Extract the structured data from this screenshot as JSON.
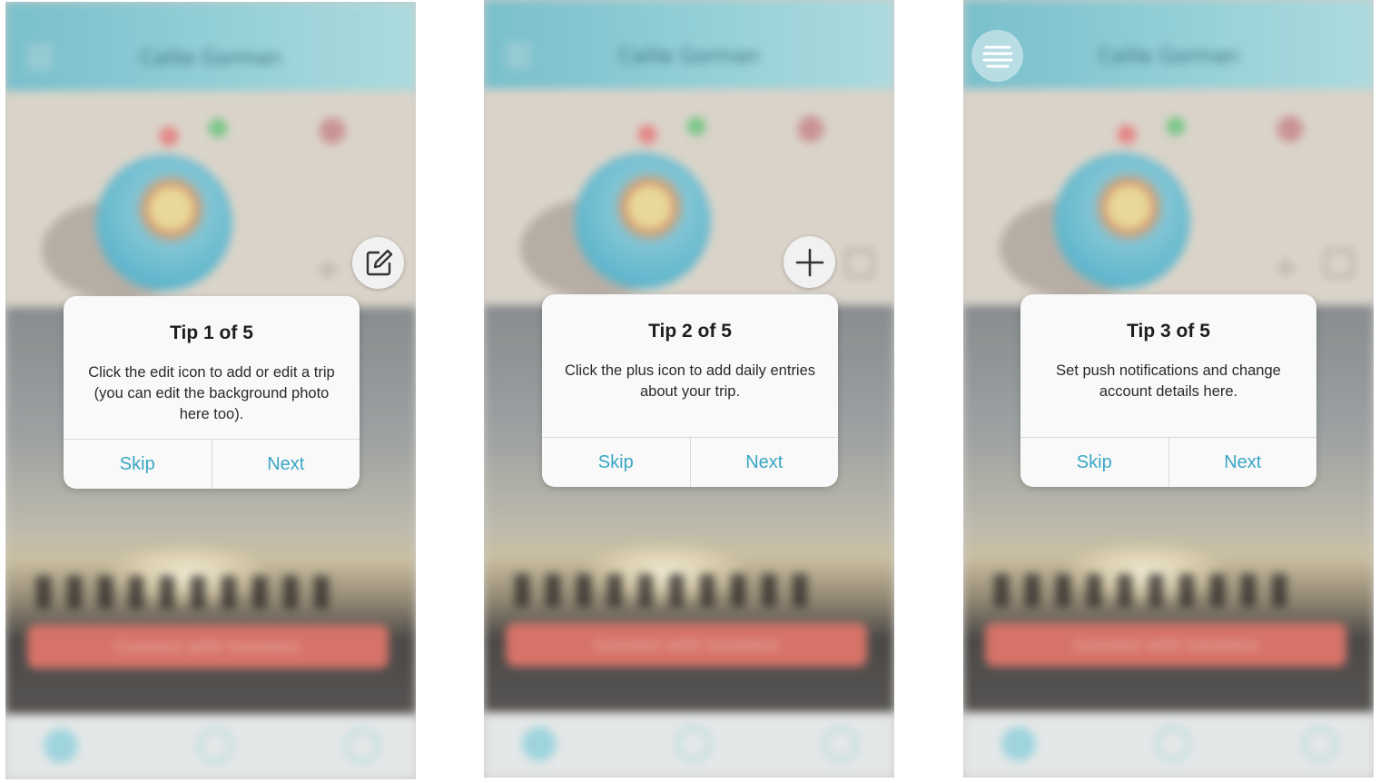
{
  "app": {
    "user_name": "Callie Gorman",
    "cta_label": "Connect with travelers",
    "colors": {
      "header": "#9fdbe2",
      "accent": "#3aa6c4",
      "cta": "#e2776c"
    }
  },
  "screens": [
    {
      "highlight_icon": "edit-icon",
      "tip": {
        "title": "Tip 1 of 5",
        "body": "Click the edit icon to add or edit a trip (you can edit the background photo here too).",
        "skip_label": "Skip",
        "next_label": "Next"
      }
    },
    {
      "highlight_icon": "plus-icon",
      "tip": {
        "title": "Tip 2 of 5",
        "body": "Click the plus icon to add daily entries about your trip.",
        "skip_label": "Skip",
        "next_label": "Next"
      }
    },
    {
      "highlight_icon": "menu-icon",
      "tip": {
        "title": "Tip 3 of 5",
        "body": "Set push notifications and change account details here.",
        "skip_label": "Skip",
        "next_label": "Next"
      }
    }
  ]
}
